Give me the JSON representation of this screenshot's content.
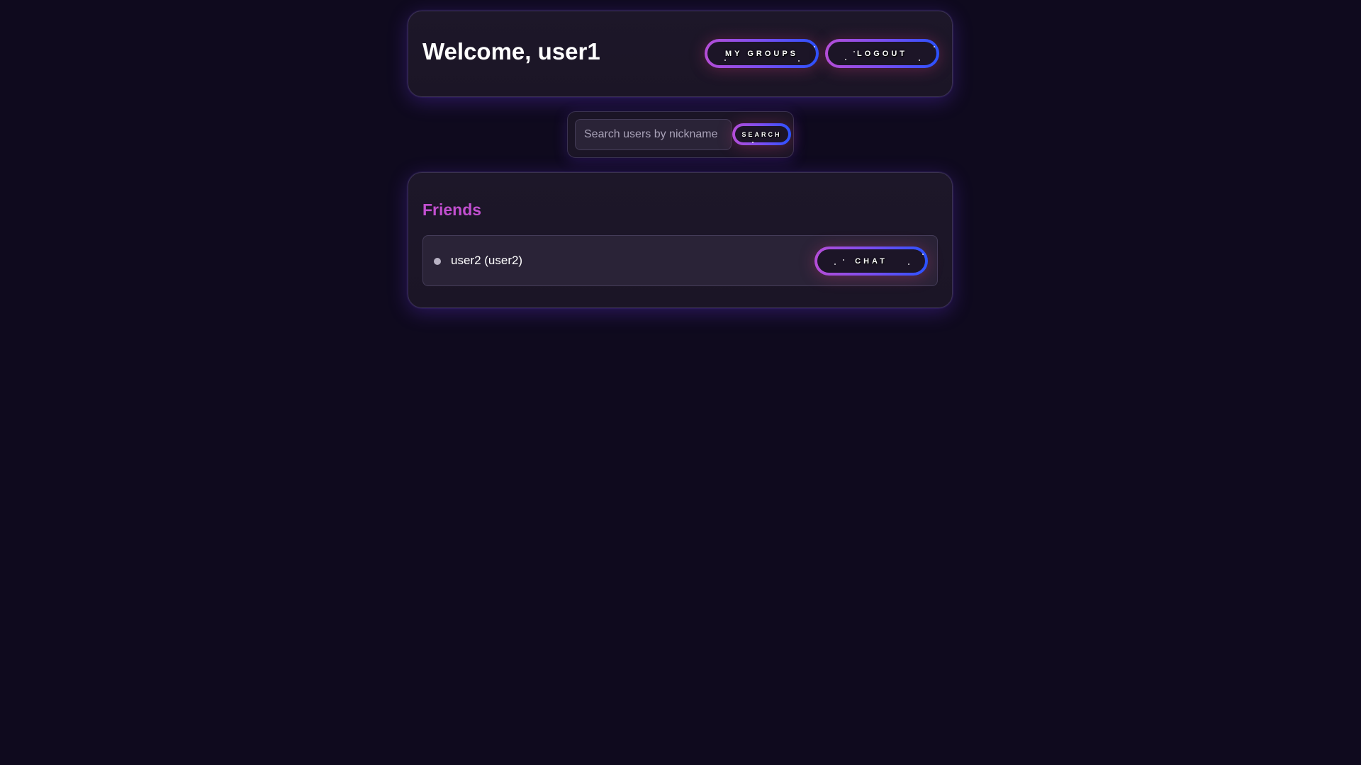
{
  "header": {
    "welcome_text": "Welcome, user1",
    "my_groups_label": "MY GROUPS",
    "logout_label": "LOGOUT"
  },
  "search": {
    "placeholder": "Search users by nickname",
    "value": "",
    "button_label": "SEARCH"
  },
  "friends": {
    "title": "Friends",
    "items": [
      {
        "name": "user2 (user2)",
        "status": "offline",
        "chat_label": "CHAT"
      }
    ]
  },
  "colors": {
    "background": "#0f0a1e",
    "card": "#1d1729",
    "accent_title": "#c24fd0",
    "button_gradient_start": "#b54dd6",
    "button_gradient_end": "#2a52ff",
    "status_dot": "#b8b2c4"
  },
  "icons": {
    "status": "status-dot-icon"
  }
}
